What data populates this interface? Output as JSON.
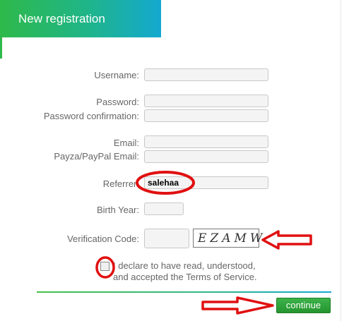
{
  "header": {
    "title": "New registration"
  },
  "form": {
    "username_label": "Username:",
    "password_label": "Password:",
    "password_confirm_label": "Password confirmation:",
    "email_label": "Email:",
    "payza_label": "Payza/PayPal Email:",
    "referrer_label": "Referrer:",
    "referrer_value": "salehaa",
    "birth_year_label": "Birth Year:",
    "verification_label": "Verification Code:",
    "captcha_text": "EZAMW",
    "terms_line1": "I declare to have read, understood,",
    "terms_line2": "and accepted the Terms of Service.",
    "continue_label": "continue"
  },
  "colors": {
    "header_gradient_start": "#2fb94a",
    "header_gradient_end": "#14a8d0",
    "button_green": "#2fa13a",
    "annotation_red": "#e01010"
  }
}
